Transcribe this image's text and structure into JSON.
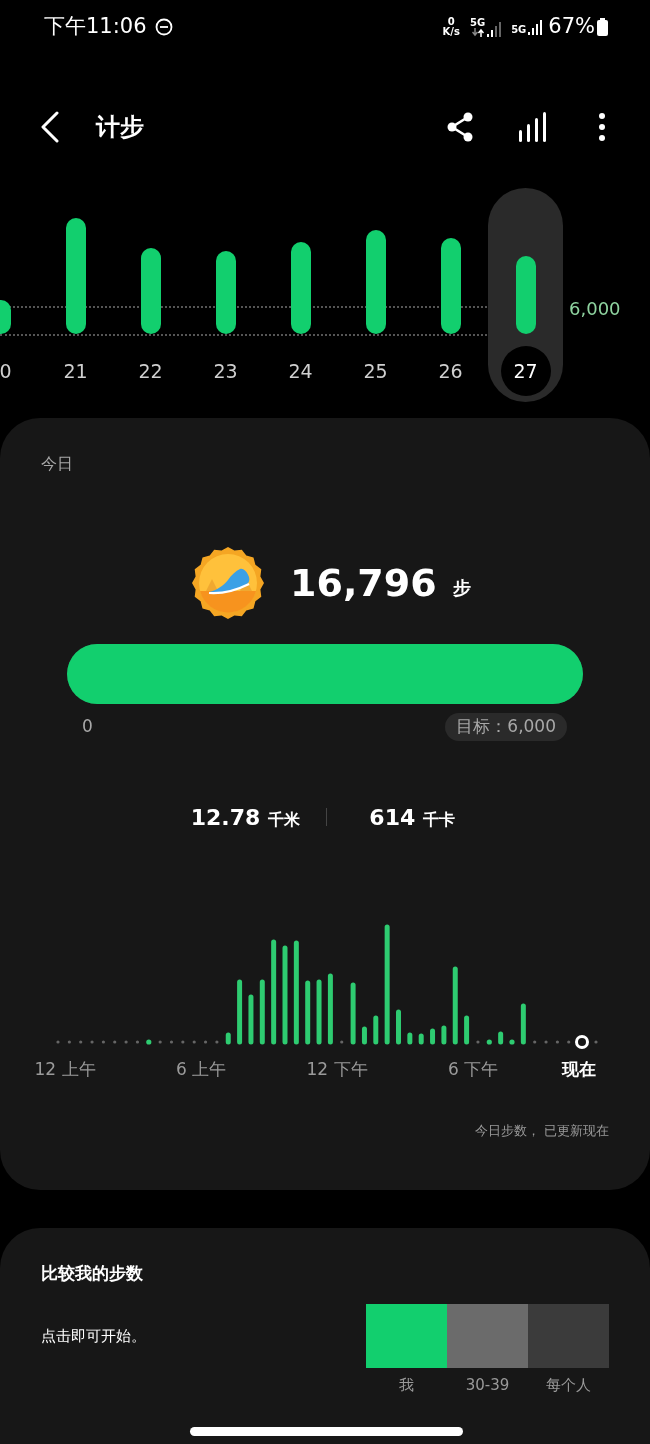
{
  "status_bar": {
    "time": "下午11:06",
    "net_speed_value": "0",
    "net_speed_unit": "K/s",
    "sim1_network": "5G",
    "sim2_network": "5G",
    "battery": "67%"
  },
  "header": {
    "title": "计步"
  },
  "daily_chart": {
    "goal_label": "6,000",
    "days": [
      {
        "label": "0",
        "selected": false
      },
      {
        "label": "21",
        "selected": false
      },
      {
        "label": "22",
        "selected": false
      },
      {
        "label": "23",
        "selected": false
      },
      {
        "label": "24",
        "selected": false
      },
      {
        "label": "25",
        "selected": false
      },
      {
        "label": "26",
        "selected": false
      },
      {
        "label": "27",
        "selected": true
      }
    ]
  },
  "today_card": {
    "title": "今日",
    "steps": "16,796",
    "steps_unit": "步",
    "progress": {
      "level": 1,
      "start_label": "0",
      "goal": "目标：6,000"
    },
    "distance": "12.78",
    "distance_unit": "千米",
    "calories": "614",
    "calories_unit": "千卡",
    "hourly_chart": {
      "axis_labels": [
        {
          "label": "12 上午",
          "current": false
        },
        {
          "label": "6 上午",
          "current": false
        },
        {
          "label": "12 下午",
          "current": false
        },
        {
          "label": "6 下午",
          "current": false
        },
        {
          "label": "现在",
          "current": true
        }
      ]
    },
    "footnote": "今日步数， 已更新现在"
  },
  "compare_card": {
    "title": "比较我的步数",
    "hint": "点击即可开始。",
    "groups": [
      {
        "label": "我",
        "color": "#12cf6e"
      },
      {
        "label": "30-39",
        "color": "#6b6b6b"
      },
      {
        "label": "每个人",
        "color": "#3b3b3b"
      }
    ]
  }
}
